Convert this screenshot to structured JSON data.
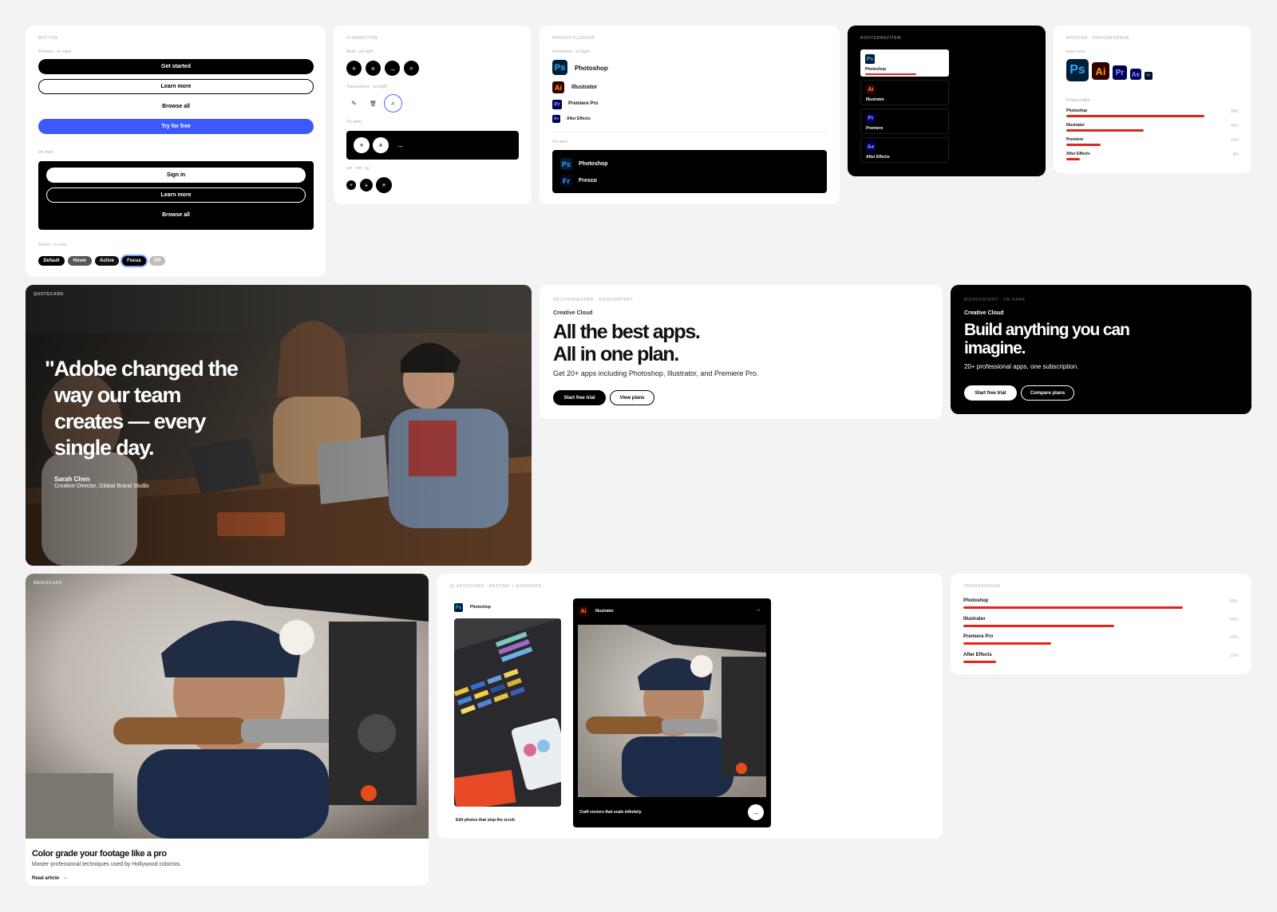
{
  "button_card": {
    "label": "BUTTON",
    "sub_light": "Primary · on light",
    "light_buttons": [
      "Get started",
      "Learn more",
      "Browse all",
      "Try for free"
    ],
    "sub_dark": "On dark",
    "dark_buttons": [
      "Sign in",
      "Learn more",
      "Browse all"
    ],
    "sub_states": "States · xs size",
    "states": [
      "Default",
      "Hover",
      "Active",
      "Focus",
      "Off"
    ]
  },
  "iconbutton_card": {
    "label": "ICONBUTTON",
    "sub_light": "Bold · on light",
    "sub_transparent": "Transparent · on light",
    "sub_dark": "On dark",
    "sub_sizes": "sm · md · lg",
    "icons_bold": [
      "+",
      "×",
      "→",
      "⌕"
    ],
    "icons_transparent": [
      "✎",
      "🗑",
      "⌕"
    ],
    "icons_dark": [
      "+",
      "×",
      "→"
    ],
    "icons_sizes": [
      "+",
      "+",
      "+"
    ]
  },
  "productlockup_card": {
    "label": "PRODUCTLOCKUP",
    "sub_horizontal": "Horizontal · on light",
    "products": [
      {
        "abbr": "Ps",
        "name": "Photoshop"
      },
      {
        "abbr": "Ai",
        "name": "Illustrator"
      },
      {
        "abbr": "Pr",
        "name": "Premiere Pro"
      },
      {
        "abbr": "Ae",
        "name": "After Effects"
      }
    ],
    "sub_dark": "On dark",
    "dark_products": [
      {
        "abbr": "Ps",
        "name": "Photoshop"
      },
      {
        "abbr": "Fr",
        "name": "Fresco"
      }
    ]
  },
  "routernavitem_card": {
    "label": "ROUTERNAVITEM",
    "items": [
      {
        "abbr": "Ps",
        "name": "Photoshop"
      },
      {
        "abbr": "Ai",
        "name": "Illustrator"
      },
      {
        "abbr": "Pr",
        "name": "Premiere"
      },
      {
        "abbr": "Ae",
        "name": "After Effects"
      }
    ],
    "active_progress": 0.65
  },
  "appicon_card": {
    "label": "APPICON · PROGRESSBAR",
    "sub_icons": "Icon sizes",
    "icons": [
      "Ps",
      "Ai",
      "Pr",
      "Ae",
      "Fr"
    ],
    "sub_progress": "ProgressBar",
    "bars": [
      {
        "name": "Photoshop",
        "pct_label": "80%",
        "value": 0.8
      },
      {
        "name": "Illustrator",
        "pct_label": "45%",
        "value": 0.45
      },
      {
        "name": "Premiere",
        "pct_label": "20%",
        "value": 0.2
      },
      {
        "name": "After Effects",
        "pct_label": "8%",
        "value": 0.08
      }
    ]
  },
  "quote_card": {
    "label": "QUOTECARD",
    "quote_lines": [
      "\"Adobe changed the",
      "way our team",
      "creates — every",
      "single day."
    ],
    "author": "Sarah Chen",
    "role": "Creative Director, Global Brand Studio"
  },
  "section_header_card": {
    "label": "SECTIONHEADER · RICHCONTENT",
    "eyebrow": "Creative Cloud",
    "heading_lines": [
      "All the best apps.",
      "All in one plan."
    ],
    "body": "Get 20+ apps including Photoshop, Illustrator, and Premiere Pro.",
    "primary_cta": "Start free trial",
    "secondary_cta": "View plans"
  },
  "rich_content_dark_card": {
    "label": "RICHCONTENT · ON DARK",
    "eyebrow": "Creative Cloud",
    "heading_lines": [
      "Build anything you can",
      "imagine."
    ],
    "body": "20+ professional apps, one subscription.",
    "primary_cta": "Start free trial",
    "secondary_cta": "Compare plans"
  },
  "media_card": {
    "label": "MEDIACARD",
    "title": "Color grade your footage like a pro",
    "description": "Master professional techniques used by Hollywood colorists.",
    "link": "Read article",
    "link_icon": "→"
  },
  "elastic_card": {
    "label": "ELASTICCARD · RESTING + EXPANDED",
    "resting": {
      "abbr": "Ps",
      "name": "Photoshop",
      "caption": "Edit photos that stop the scroll."
    },
    "expanded": {
      "abbr": "Ai",
      "name": "Illustrator",
      "caption": "Craft vectors that scale infinitely.",
      "arrow": "→"
    }
  },
  "progressbar_card": {
    "label": "PROGRESSBAR",
    "bars": [
      {
        "name": "Photoshop",
        "pct_label": "80%",
        "value": 0.8
      },
      {
        "name": "Illustrator",
        "pct_label": "55%",
        "value": 0.55
      },
      {
        "name": "Premiere Pro",
        "pct_label": "32%",
        "value": 0.32
      },
      {
        "name": "After Effects",
        "pct_label": "12%",
        "value": 0.12
      }
    ]
  },
  "colors": {
    "accent_red": "#e1251b",
    "accent_blue": "#3d5afe"
  }
}
